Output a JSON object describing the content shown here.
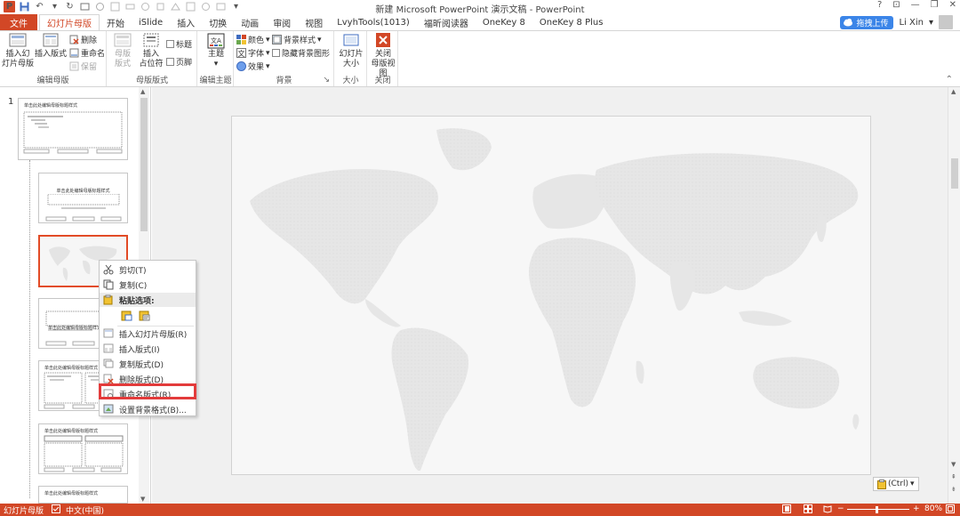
{
  "window": {
    "title": "新建 Microsoft PowerPoint 演示文稿 - PowerPoint",
    "help": "?",
    "minimize": "—",
    "restore": "❐",
    "close": "✕",
    "ribbon_display": "⊡"
  },
  "tabs": {
    "file": "文件",
    "items": [
      "幻灯片母版",
      "开始",
      "iSlide",
      "插入",
      "切换",
      "动画",
      "审阅",
      "视图",
      "LvyhTools(1013)",
      "福昕阅读器",
      "OneKey 8",
      "OneKey 8 Plus"
    ],
    "active_index": 0
  },
  "account": {
    "upload": "拖拽上传",
    "user": "Li Xin",
    "dropdown": "▾"
  },
  "ribbon": {
    "edit_master": {
      "label": "编辑母版",
      "insert_master": "插入幻\n灯片母版",
      "insert_layout": "插入版式",
      "delete": "删除",
      "rename": "重命名",
      "preserve": "保留"
    },
    "master_layout": {
      "label": "母版版式",
      "master_layout_btn": "母版\n版式",
      "insert_placeholder": "插入\n占位符",
      "title_chk": "标题",
      "footer_chk": "页脚"
    },
    "edit_theme": {
      "label": "编辑主题",
      "theme": "主题"
    },
    "background": {
      "label": "背景",
      "colors": "颜色",
      "fonts": "字体",
      "effects": "效果",
      "bg_styles": "背景样式",
      "hide_bg": "隐藏背景图形"
    },
    "size": {
      "label": "大小",
      "slide_size": "幻灯片\n大小"
    },
    "close": {
      "label": "关闭",
      "close_master": "关闭\n母版视图"
    }
  },
  "thumbnails": {
    "slide_number": "1",
    "master_title": "单击此处编辑母版标题样式",
    "layout2_title": "单击此处编辑母版标题样式",
    "layout4_title": "单击此处编辑母版标题样式",
    "layout5_title": "单击此处编辑母版标题样式",
    "layout6_title": "单击此处编辑母版标题样式",
    "layout7_title": "单击此处编辑母版标题样式"
  },
  "context_menu": {
    "cut": "剪切(T)",
    "copy": "复制(C)",
    "paste_options": "粘贴选项:",
    "insert_master": "插入幻灯片母版(R)",
    "insert_layout": "插入版式(I)",
    "duplicate_layout": "复制版式(D)",
    "delete_layout": "删除版式(D)",
    "rename_layout": "重命名版式(R)",
    "format_background": "设置背景格式(B)..."
  },
  "canvas": {
    "paste_ctrl": "(Ctrl)",
    "paste_ctrl_arrow": "▾"
  },
  "statusbar": {
    "view_name": "幻灯片母版",
    "language": "中文(中国)",
    "zoom": "80%"
  },
  "colors": {
    "accent": "#d24726",
    "highlight": "#e33b3b",
    "selection": "#e24b26"
  }
}
